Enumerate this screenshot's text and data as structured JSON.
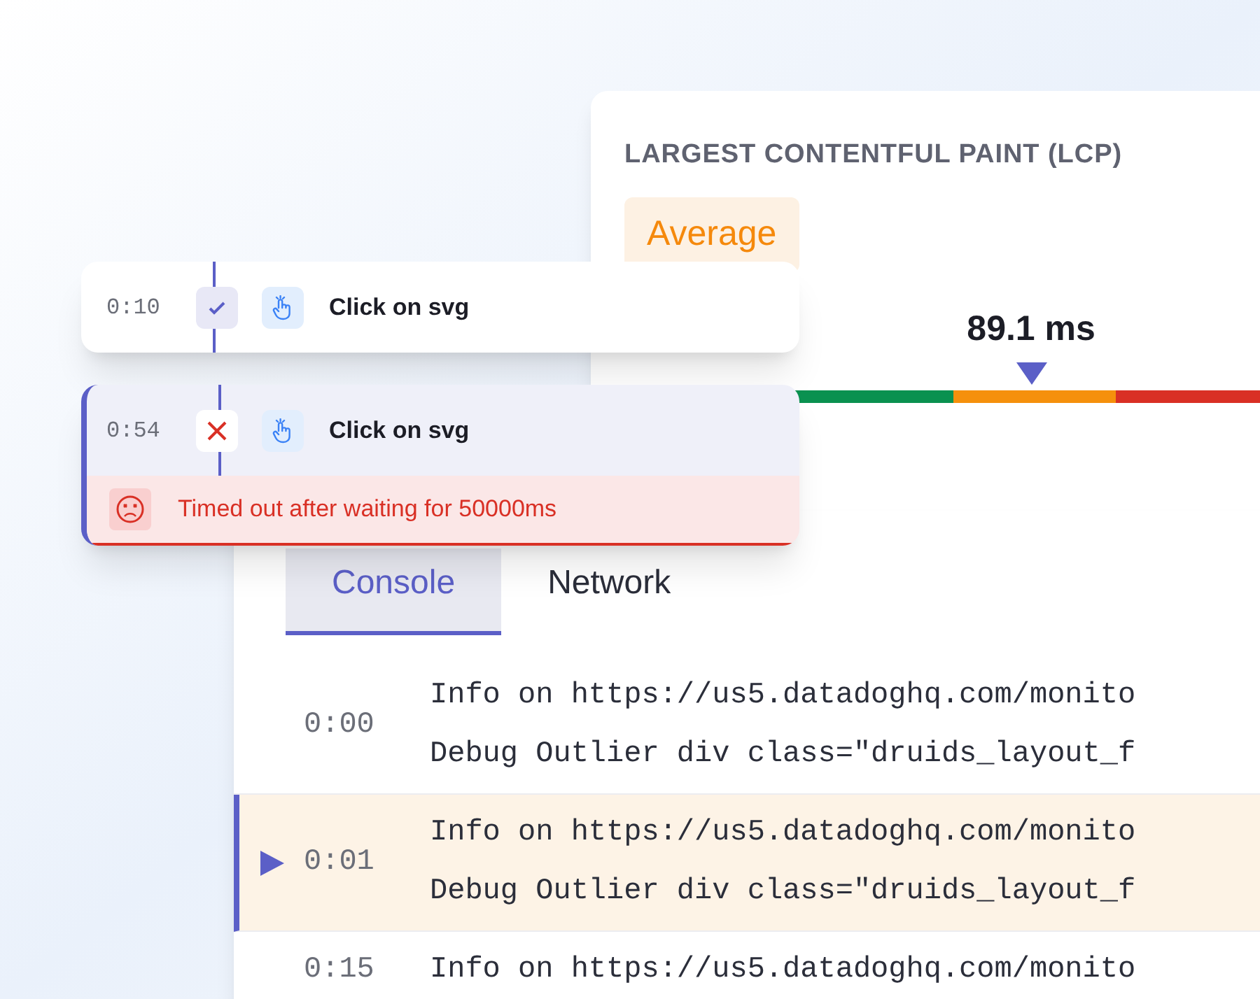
{
  "metric": {
    "title": "LARGEST CONTENTFUL PAINT (LCP)",
    "rating": "Average",
    "value": "89.1 ms",
    "level": 0.64
  },
  "steps": [
    {
      "time": "0:10",
      "kind": "passed",
      "label": "Click on svg",
      "selected": false
    },
    {
      "time": "0:54",
      "kind": "failed",
      "label": "Click on svg",
      "selected": true,
      "error": "Timed out after waiting for 50000ms"
    }
  ],
  "tabs": [
    {
      "label": "Console",
      "selected": true
    },
    {
      "label": "Network",
      "selected": false
    }
  ],
  "logs": [
    {
      "time": "0:00",
      "lines": [
        "Info on https://us5.datadoghq.com/monito",
        "Debug Outlier div class=\"druids_layout_f"
      ],
      "selected": false
    },
    {
      "time": "0:01",
      "lines": [
        "Info on https://us5.datadoghq.com/monito",
        "Debug Outlier div class=\"druids_layout_f"
      ],
      "selected": true
    },
    {
      "time": "0:15",
      "lines": [
        "Info on https://us5.datadoghq.com/monito"
      ],
      "selected": false
    }
  ]
}
